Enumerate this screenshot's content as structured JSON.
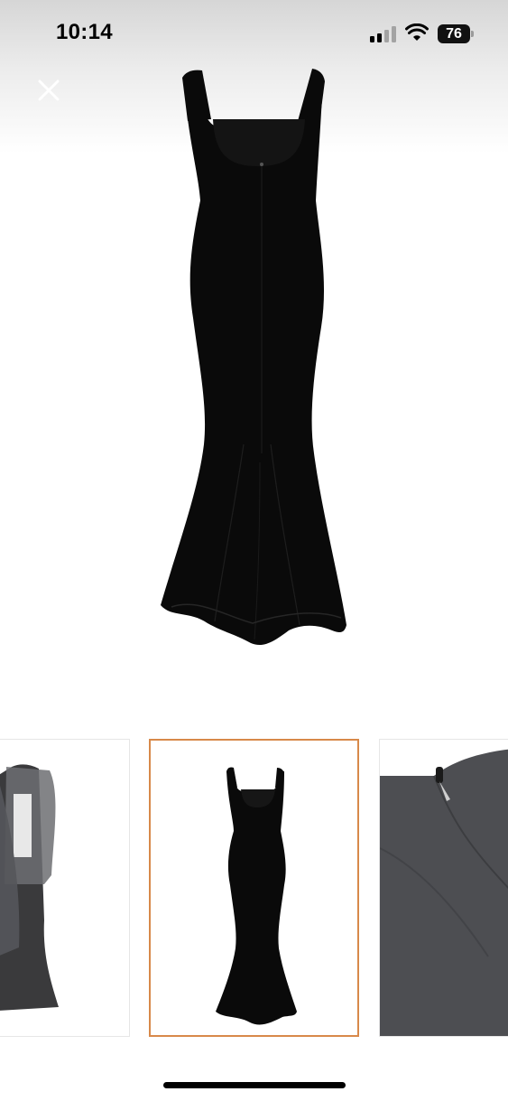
{
  "status_bar": {
    "time": "10:14",
    "battery_level": "76",
    "icons": [
      "signal-icon",
      "wifi-icon",
      "battery-icon"
    ]
  },
  "viewer": {
    "close_icon": "close-icon",
    "hero_image": "black-sleeveless-mermaid-gown-back-view"
  },
  "thumbnails": [
    {
      "image": "gown-with-sheer-scarf-back-view",
      "selected": false
    },
    {
      "image": "black-sleeveless-mermaid-gown-back-view",
      "selected": true
    },
    {
      "image": "zipper-closeup",
      "selected": false
    }
  ],
  "colors": {
    "selected_border": "#d8894a",
    "garment": "#0a0a0a"
  }
}
